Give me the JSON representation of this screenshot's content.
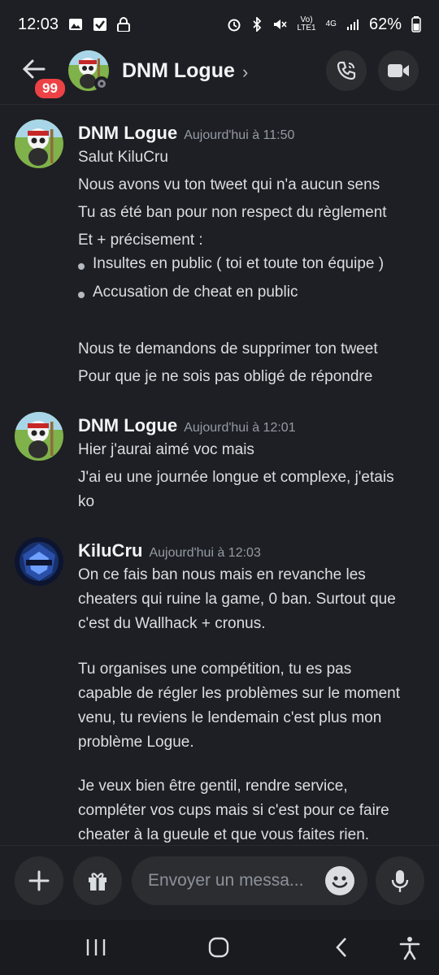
{
  "statusbar": {
    "time": "12:03",
    "battery": "62%",
    "network_top": "Vo)",
    "network_bottom": "LTE1",
    "network_gen": "4G"
  },
  "header": {
    "back_badge": "99",
    "title": "DNM Logue",
    "chevron": "›"
  },
  "messages": [
    {
      "author": "DNM Logue",
      "time": "Aujourd'hui à 11:50",
      "lines": [
        "Salut KiluCru",
        "Nous avons vu ton tweet qui n'a aucun sens",
        "Tu as été ban pour non respect du règlement",
        "Et + précisement :"
      ],
      "bullets": [
        "Insultes en public ( toi et toute ton équipe )",
        "Accusation de cheat en public"
      ],
      "lines_after": [
        "Nous te demandons de supprimer ton tweet",
        "Pour que je ne sois pas obligé de répondre"
      ]
    },
    {
      "author": "DNM Logue",
      "time": "Aujourd'hui à 12:01",
      "lines": [
        "Hier j'aurai aimé voc mais",
        "J'ai eu une journée longue et complexe, j'etais",
        "ko"
      ]
    },
    {
      "author": "KiluCru",
      "time": "Aujourd'hui à 12:03",
      "lines": [
        "On ce fais ban nous mais en revanche les",
        "cheaters qui ruine la game, 0 ban. Surtout que",
        "c'est du Wallhack + cronus.",
        "",
        "Tu organises une compétition, tu es pas",
        "capable de régler les problèmes sur le moment",
        "venu, tu reviens le lendemain c'est plus mon",
        "problème Logue.",
        "",
        "Je veux bien être gentil, rendre service,",
        "compléter vos cups mais si c'est pour ce faire",
        "cheater à la gueule et que vous faites rien."
      ]
    }
  ],
  "composer": {
    "placeholder": "Envoyer un messa..."
  },
  "colors": {
    "background": "#1e1f24",
    "badge": "#ed4245",
    "timestamp": "#949ba4"
  },
  "icons": [
    "back-arrow-icon",
    "phone-icon",
    "video-camera-icon",
    "plus-icon",
    "gift-icon",
    "emoji-icon",
    "microphone-icon",
    "recents-icon",
    "home-icon",
    "back-icon",
    "accessibility-icon"
  ]
}
